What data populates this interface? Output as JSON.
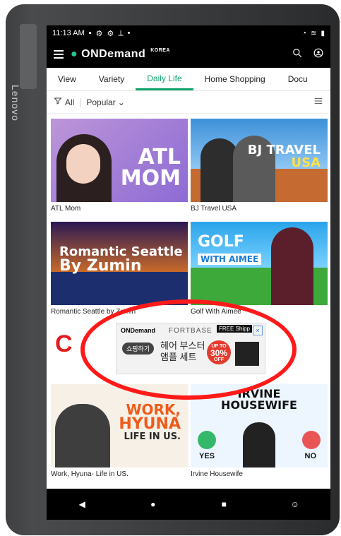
{
  "device": {
    "brand_text": "Lenovo"
  },
  "status_bar": {
    "time": "11:13 AM",
    "left_icons": [
      "notification-icon",
      "settings-icon",
      "settings-icon",
      "signal-icon",
      "dot-icon"
    ],
    "right_icons": [
      "alarm-icon",
      "wifi-icon",
      "battery-icon"
    ]
  },
  "app_bar": {
    "logo_main": "ONDemand",
    "logo_sub": "KOREA",
    "actions": [
      "search-icon",
      "profile-icon"
    ]
  },
  "tabs": [
    {
      "label": "View"
    },
    {
      "label": "Variety"
    },
    {
      "label": "Daily Life",
      "active": true
    },
    {
      "label": "Home Shopping"
    },
    {
      "label": "Docu"
    }
  ],
  "filter": {
    "filter_label": "All",
    "sort_label": "Popular",
    "list_icon": "list-view-icon"
  },
  "cards": [
    {
      "title": "ATL Mom",
      "thumb_text": [
        "ATL",
        "MOM"
      ]
    },
    {
      "title": "BJ Travel USA",
      "thumb_text": [
        "BJ TRAVEL",
        "USA"
      ]
    },
    {
      "title": "Romantic Seattle by Zumin",
      "thumb_text": [
        "Romantic Seattle",
        "By Zumin"
      ]
    },
    {
      "title": "Golf With Aimee",
      "thumb_text": [
        "GOLF",
        "WITH AIMEE"
      ]
    },
    {
      "title": "Work, Hyuna- Life in US.",
      "thumb_text": [
        "WORK,",
        "HYUNA",
        "LIFE IN US."
      ]
    },
    {
      "title": "Irvine Housewife",
      "thumb_text": [
        "IRVINE",
        "HOUSEWIFE",
        "YES",
        "NO"
      ]
    }
  ],
  "ad": {
    "logo": "ONDemand",
    "brand": "FORTBASE",
    "cta": "쇼핑하기",
    "headline_line1": "헤어 부스터",
    "headline_line2": "앰플 세트",
    "badge_top": "UP TO",
    "badge_value": "30%",
    "badge_bottom": "OFF",
    "free_shipping": "FREE Shipp"
  },
  "callout": {
    "label": "C"
  },
  "nav_bar": {
    "items": [
      "back-icon",
      "home-icon",
      "recents-icon",
      "accessibility-icon"
    ]
  }
}
